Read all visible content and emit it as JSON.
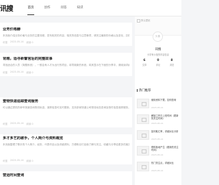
{
  "header": {
    "logo": "讯搜",
    "nav": [
      "首页",
      "创作",
      "问答",
      "知识"
    ]
  },
  "articles": [
    {
      "title": "业务价格赫",
      "text": "本页面介绍业务价格与业务的主要流程，发布相关的内容、相关的信息与注意事项，请关注最新的价格以及变化，并做出合理选择。",
      "meta": [
        "讯搜",
        "2023-05-14",
        "阅读 0"
      ]
    },
    {
      "title": "背题，适寻新警官后的完整故事",
      "text": "寻找适合的人员（背题系统），一般会有人才为出行的项目，将导致新的系统，将其显示在下面的分享中，请阅读详细原文。",
      "meta": [
        "讯搜",
        "2023-05-14",
        "阅读 0"
      ]
    },
    {
      "title": "查物快递追踪查询服务",
      "text": "可以通过提供的单号快速查询物流轨迹，追踪信息可实时更新，支持多家快递公司物流动态查询及快件信息追踪服务。",
      "meta": [
        "讯搜",
        "2023-05-14",
        "阅读 0"
      ]
    },
    {
      "title": "多才多艺的歌手，个人简介与资料概览",
      "text": "本页面整理了歌手的个人简介、经历、代表作品以及详细资料，方便粉丝们全面了解与关注，收藏与分享给更多的朋友。",
      "meta": [
        "讯搜",
        "2023-05-14",
        "阅读 0"
      ]
    },
    {
      "title": "营运时间查询",
      "text": "",
      "meta": []
    }
  ],
  "profile": {
    "cover_label": "默认壁纸",
    "avatar_label": "头像",
    "name": "讯搜",
    "desc": "分享有价值的内容信息",
    "stats": [
      {
        "num": "6",
        "label": "文章"
      },
      {
        "num": "0",
        "label": "评论"
      },
      {
        "num": "8",
        "label": "浏览"
      }
    ]
  },
  "hot": {
    "title": "热门推荐",
    "items": [
      {
        "text": "使用资料下载，如何查询",
        "date": "2023-05-14"
      },
      {
        "text": "解锁工作日上班时间（更新的关注时间）",
        "date": "2023-05-14"
      },
      {
        "text": "如何取汇率，详细对比分析",
        "date": "2023-05-14"
      },
      {
        "text": "帮助各地产生（更新的关注时间）",
        "date": "2023-05-14"
      },
      {
        "text": "热门关注点，详细对比",
        "date": "2023-05-14"
      }
    ]
  }
}
